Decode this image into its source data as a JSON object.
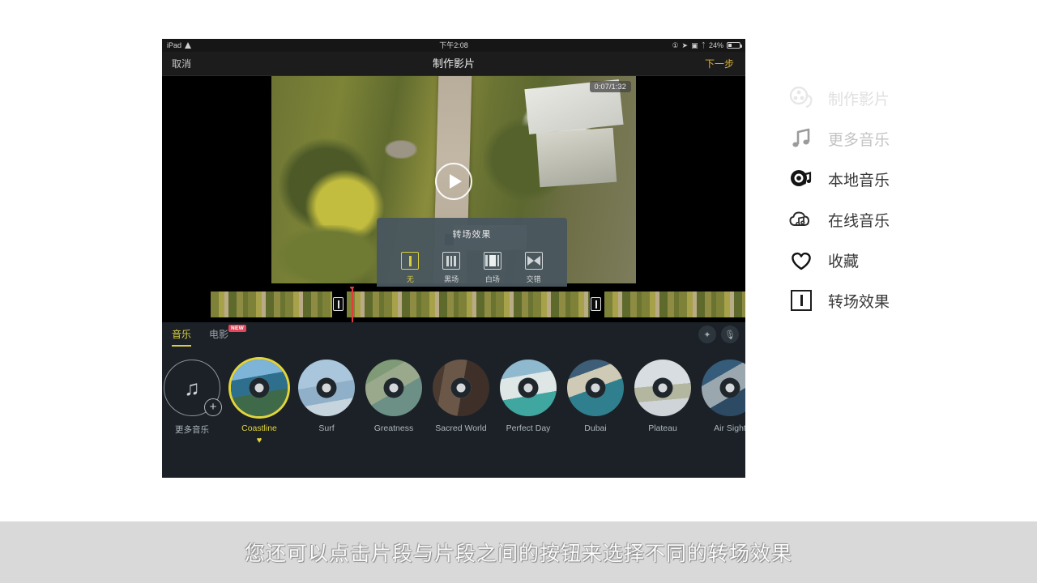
{
  "device": {
    "status_bar": {
      "carrier": "iPad",
      "wifi_icon": "wifi-icon",
      "time": "下午2:08",
      "alarm_icon": "alarm-icon",
      "location_icon": "location-arrow-icon",
      "rotation_lock_icon": "rotation-lock-icon",
      "bluetooth_icon": "bluetooth-icon",
      "battery_percent": "24%"
    },
    "nav_bar": {
      "cancel_label": "取消",
      "title": "制作影片",
      "next_label": "下一步"
    },
    "preview": {
      "timecode": "0:07/1:32",
      "play_icon": "play-icon"
    },
    "transition_popup": {
      "title": "转场效果",
      "options": [
        {
          "label": "无",
          "icon": "transition-none-icon",
          "selected": true
        },
        {
          "label": "黑场",
          "icon": "transition-black-icon",
          "selected": false
        },
        {
          "label": "白场",
          "icon": "transition-white-icon",
          "selected": false
        },
        {
          "label": "交错",
          "icon": "transition-cross-icon",
          "selected": false
        }
      ]
    },
    "toolbar": {
      "tabs": [
        {
          "label": "音乐",
          "selected": true,
          "badge": ""
        },
        {
          "label": "电影",
          "selected": false,
          "badge": "NEW"
        }
      ],
      "wand_icon": "magic-wand-icon",
      "mic_icon": "microphone-muted-icon"
    },
    "music": {
      "add_label": "更多音乐",
      "add_icon": "music-note-icon",
      "plus_icon": "plus-icon",
      "tracks": [
        {
          "label": "Coastline",
          "selected": true,
          "favorite": "♥"
        },
        {
          "label": "Surf",
          "selected": false,
          "favorite": ""
        },
        {
          "label": "Greatness",
          "selected": false,
          "favorite": ""
        },
        {
          "label": "Sacred World",
          "selected": false,
          "favorite": ""
        },
        {
          "label": "Perfect Day",
          "selected": false,
          "favorite": ""
        },
        {
          "label": "Dubai",
          "selected": false,
          "favorite": ""
        },
        {
          "label": "Plateau",
          "selected": false,
          "favorite": ""
        },
        {
          "label": "Air Sight",
          "selected": false,
          "favorite": ""
        }
      ]
    }
  },
  "sidebar": {
    "items": [
      {
        "label": "制作影片",
        "icon": "film-reel-icon",
        "state": "faded"
      },
      {
        "label": "更多音乐",
        "icon": "music-note-icon",
        "state": "dim"
      },
      {
        "label": "本地音乐",
        "icon": "vinyl-record-icon",
        "state": "normal"
      },
      {
        "label": "在线音乐",
        "icon": "cloud-music-icon",
        "state": "normal"
      },
      {
        "label": "收藏",
        "icon": "heart-icon",
        "state": "normal"
      },
      {
        "label": "转场效果",
        "icon": "transition-square-icon",
        "state": "normal"
      }
    ]
  },
  "caption": {
    "text": "您还可以点击片段与片段之间的按钮来选择不同的转场效果"
  },
  "colors": {
    "accent_yellow": "#d9cf3d",
    "badge_red": "#e0475a",
    "playhead_red": "#e23c3c",
    "panel_dark": "#1b2127",
    "popup_slate": "#49565e"
  }
}
